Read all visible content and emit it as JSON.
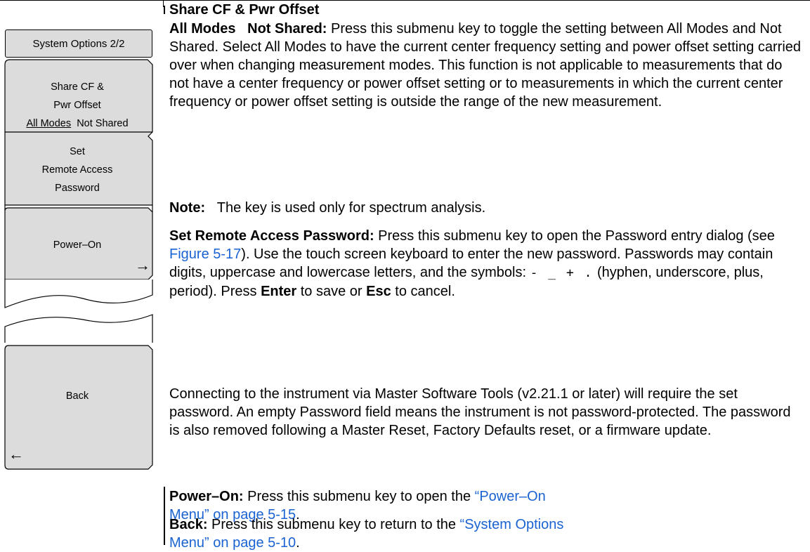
{
  "menu": {
    "title": "System Options 2/2",
    "keys": [
      {
        "line1": "Share CF &",
        "line2": "Pwr Offset",
        "option_a": "All Modes",
        "option_b": "Not Shared"
      },
      {
        "line1": "Set",
        "line2": "Remote Access",
        "line3": "Password"
      },
      {
        "label": "Power–On",
        "arrow": "→"
      },
      {
        "label": "Back",
        "arrow": "←"
      }
    ]
  },
  "content": {
    "heading": "Share CF & Pwr Offset",
    "share": {
      "term": "All Modes   Not Shared:",
      "text": " Press this submenu key to toggle the setting between All Modes and Not Shared. Select All Modes to have the current center frequency setting and power offset setting carried over when changing measurement modes. This function is not applicable to measurements that do not have a center frequency or power offset setting or to measurements in which the current center frequency or power offset setting is outside the range of the new measurement."
    },
    "note": {
      "term": "Note:",
      "text": "The key is used only for spectrum analysis."
    },
    "password": {
      "term": "Set Remote Access Password:",
      "text1": " Press this submenu key to open the Password entry dialog (see ",
      "link": "Figure 5-17",
      "text2": "). Use the touch screen keyboard to enter the new password. Passwords may contain digits, uppercase and lowercase letters, and the symbols: ",
      "symbols": "- _ + .",
      "text3": " (hyphen, underscore, plus, period). Press ",
      "enter": "Enter",
      "text4": " to save or ",
      "esc": "Esc",
      "text5": " to cancel."
    },
    "connecting": "Connecting to the instrument via Master Software Tools (v2.21.1 or later) will require the set password. An empty Password field means the instrument is not password-protected. The password is also removed following a Master Reset, Factory Defaults reset, or a firmware update.",
    "poweron": {
      "term": "Power–On:",
      "text": " Press this submenu key to open the ",
      "link1": "“Power–On Menu”",
      "link2": "on page 5-15",
      "end": "."
    },
    "back": {
      "term": "Back:",
      "text": " Press this submenu key to return to the ",
      "link1": "“System Options Menu”",
      "link2": "on page 5-10",
      "end": "."
    }
  }
}
